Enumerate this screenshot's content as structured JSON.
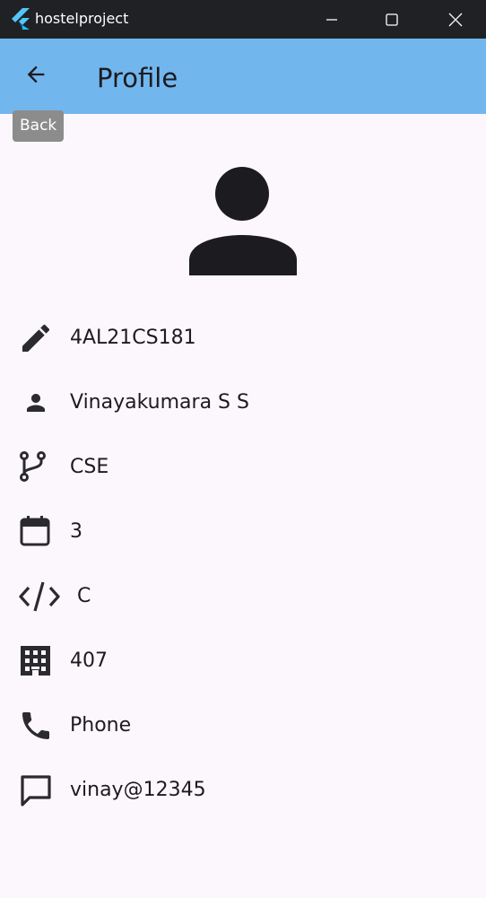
{
  "window": {
    "title": "hostelproject",
    "app_icon": "flutter-icon",
    "controls": [
      "minimize-icon",
      "maximize-icon",
      "close-icon"
    ]
  },
  "appbar": {
    "title": "Profile",
    "back_icon": "arrow-back-icon",
    "back_tooltip": "Back",
    "background": "#72b6ee"
  },
  "profile": {
    "avatar_icon": "person-icon",
    "rows": [
      {
        "icon": "edit-icon",
        "value": "4AL21CS181"
      },
      {
        "icon": "person-icon",
        "value": "Vinayakumara S S"
      },
      {
        "icon": "branch-icon",
        "value": "CSE"
      },
      {
        "icon": "calendar-icon",
        "value": "3"
      },
      {
        "icon": "code-icon",
        "value": "C"
      },
      {
        "icon": "building-icon",
        "value": "407"
      },
      {
        "icon": "phone-icon",
        "value": "Phone"
      },
      {
        "icon": "message-icon",
        "value": "vinay@12345"
      }
    ]
  },
  "colors": {
    "background": "#fcf7fd",
    "titlebar": "#202124",
    "icon": "#2b2a2e"
  }
}
